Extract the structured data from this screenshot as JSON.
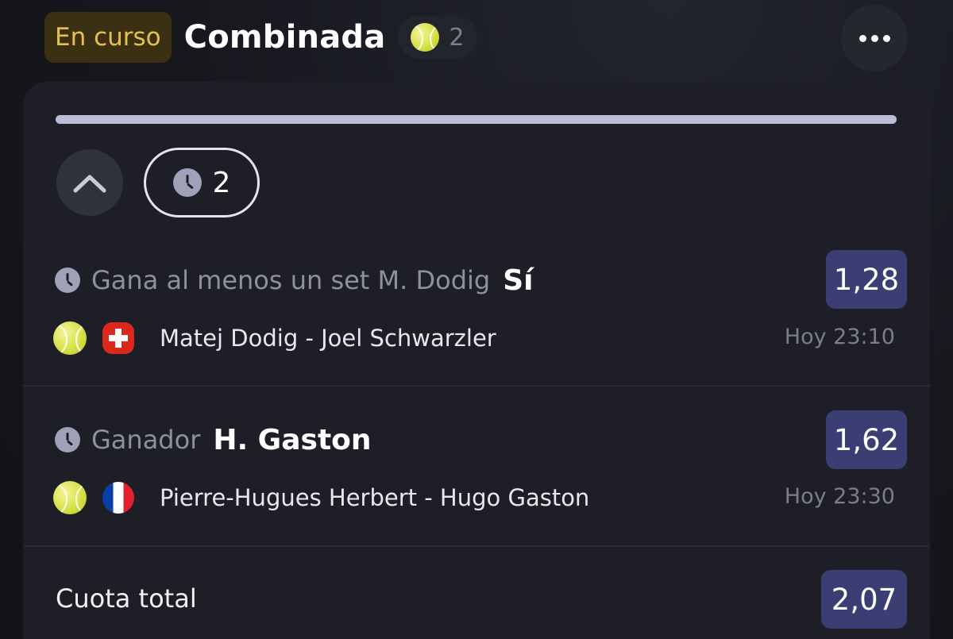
{
  "header": {
    "status": "En curso",
    "title": "Combinada",
    "sport_count": "2",
    "sport_icon": "tennis-ball-icon",
    "more_icon": "more-dots-icon"
  },
  "progress": {
    "fraction": 1.0
  },
  "summary": {
    "pending_count": "2",
    "collapse_icon": "chevron-up-icon",
    "pending_icon": "clock-icon"
  },
  "bets": [
    {
      "market": "Gana al menos un set M. Dodig",
      "selection": "Sí",
      "odds": "1,28",
      "event": "Matej Dodig - Joel Schwarzler",
      "time": "Hoy 23:10",
      "flag_icon": "switzerland-flag-icon"
    },
    {
      "market": "Ganador",
      "selection": "H. Gaston",
      "odds": "1,62",
      "event": "Pierre-Hugues Herbert - Hugo Gaston",
      "time": "Hoy 23:30",
      "flag_icon": "france-flag-icon"
    }
  ],
  "total": {
    "label": "Cuota total",
    "odds": "2,07"
  },
  "colors": {
    "accent_odds": "#3a3e72",
    "status_bg": "#3b3112",
    "status_text": "#e6c04e",
    "card_bg": "#1d1e26"
  }
}
